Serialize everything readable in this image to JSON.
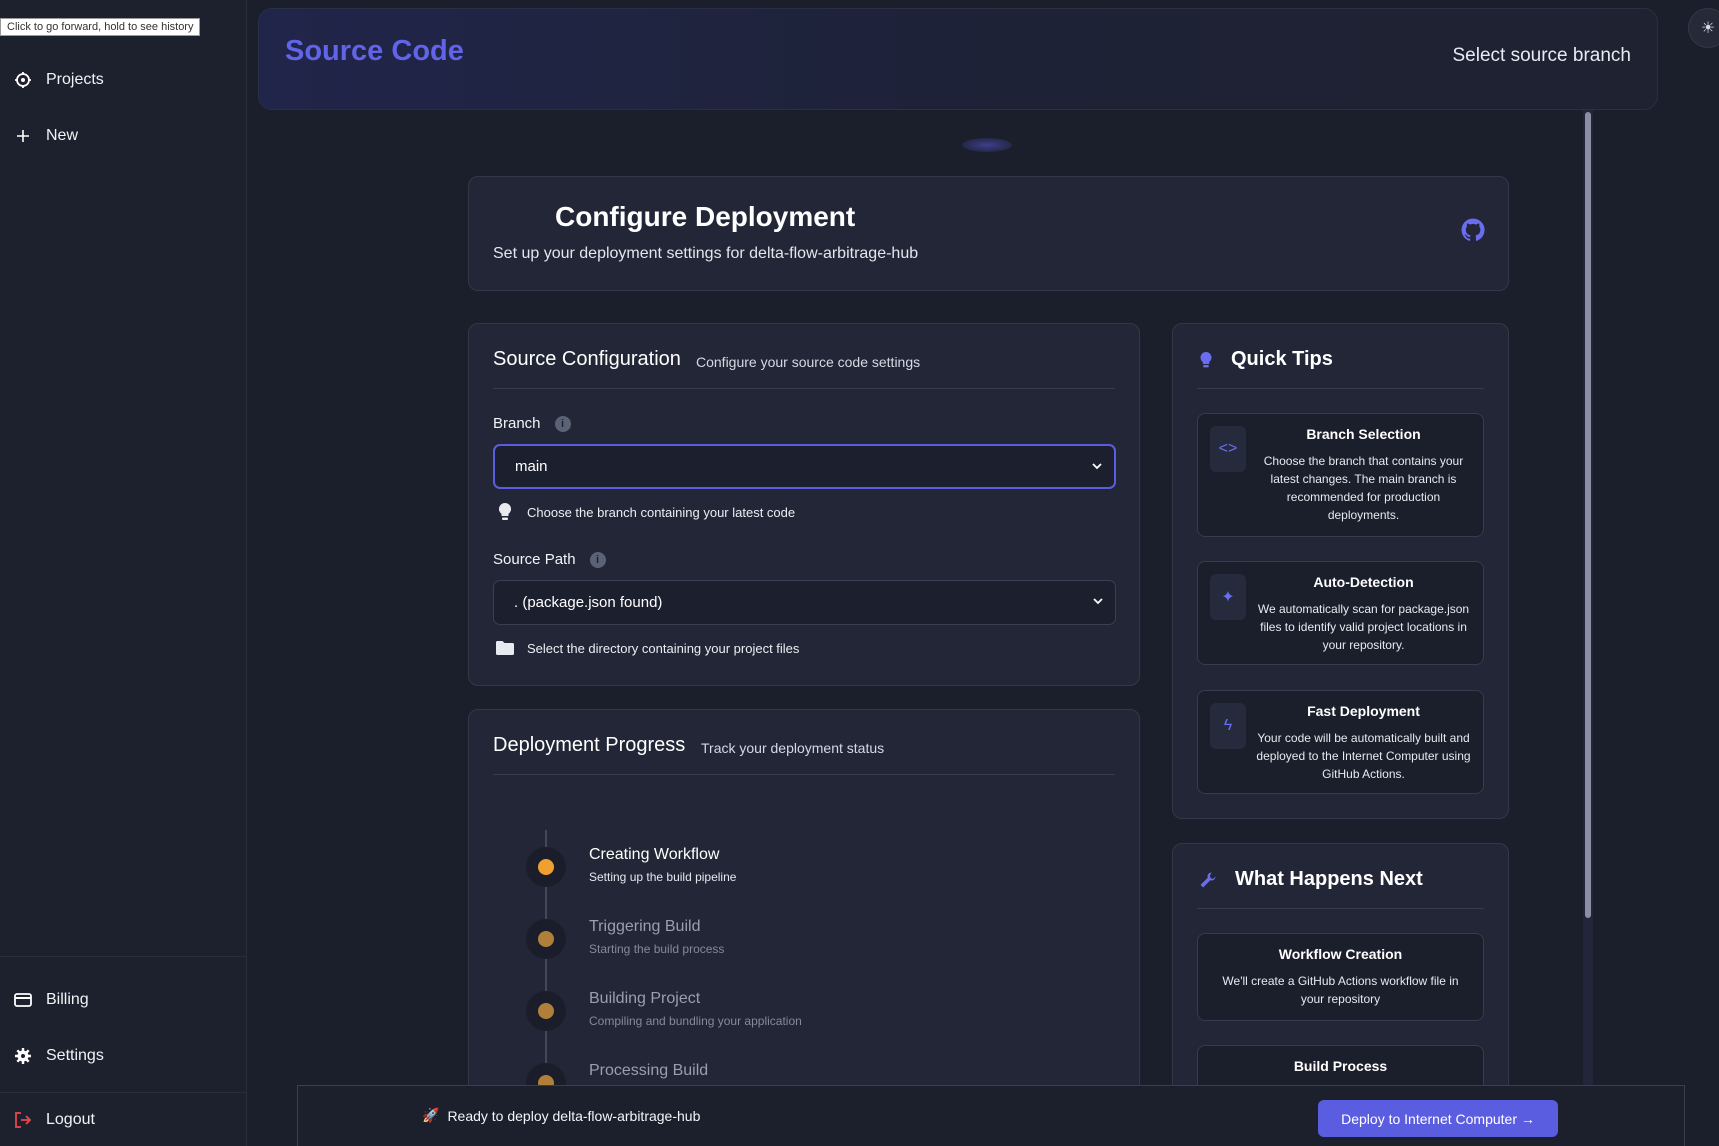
{
  "tooltip": "Click to go forward, hold to see history",
  "sidebar": {
    "items": [
      {
        "label": "Projects",
        "icon": "projects-icon"
      },
      {
        "label": "New",
        "icon": "plus-icon"
      },
      {
        "label": "Billing",
        "icon": "card-icon"
      },
      {
        "label": "Settings",
        "icon": "gear-icon"
      },
      {
        "label": "Logout",
        "icon": "logout-icon"
      }
    ]
  },
  "header": {
    "title": "Source Code",
    "right_text": "Select source branch"
  },
  "configure": {
    "title": "Configure Deployment",
    "subtitle": "Set up your deployment settings for delta-flow-arbitrage-hub"
  },
  "source_config": {
    "title": "Source Configuration",
    "subtitle": "Configure your source code settings",
    "branch_label": "Branch",
    "branch_value": "main",
    "branch_hint": "Choose the branch containing your latest code",
    "path_label": "Source Path",
    "path_value": ". (package.json found)",
    "path_hint": "Select the directory containing your project files"
  },
  "progress": {
    "title": "Deployment Progress",
    "subtitle": "Track your deployment status",
    "steps": [
      {
        "title": "Creating Workflow",
        "desc": "Setting up the build pipeline"
      },
      {
        "title": "Triggering Build",
        "desc": "Starting the build process"
      },
      {
        "title": "Building Project",
        "desc": "Compiling and bundling your application"
      },
      {
        "title": "Processing Build",
        "desc": ""
      }
    ]
  },
  "quick_tips": {
    "title": "Quick Tips",
    "tips": [
      {
        "title": "Branch Selection",
        "text": "Choose the branch that contains your latest changes. The main branch is recommended for production deployments.",
        "icon": "code-icon"
      },
      {
        "title": "Auto-Detection",
        "text": "We automatically scan for package.json files to identify valid project locations in your repository.",
        "icon": "sparkles-icon"
      },
      {
        "title": "Fast Deployment",
        "text": "Your code will be automatically built and deployed to the Internet Computer using GitHub Actions.",
        "icon": "bolt-icon"
      }
    ]
  },
  "next": {
    "title": "What Happens Next",
    "items": [
      {
        "title": "Workflow Creation",
        "text": "We'll create a GitHub Actions workflow file in your repository"
      },
      {
        "title": "Build Process",
        "text": ""
      }
    ]
  },
  "footer": {
    "message": "Ready to deploy delta-flow-arbitrage-hub",
    "button": "Deploy to Internet Computer →"
  },
  "colors": {
    "accent": "#5b5de0",
    "title_accent": "#6264e8",
    "active_step": "#f0a030",
    "pending_step": "#b0803a"
  }
}
